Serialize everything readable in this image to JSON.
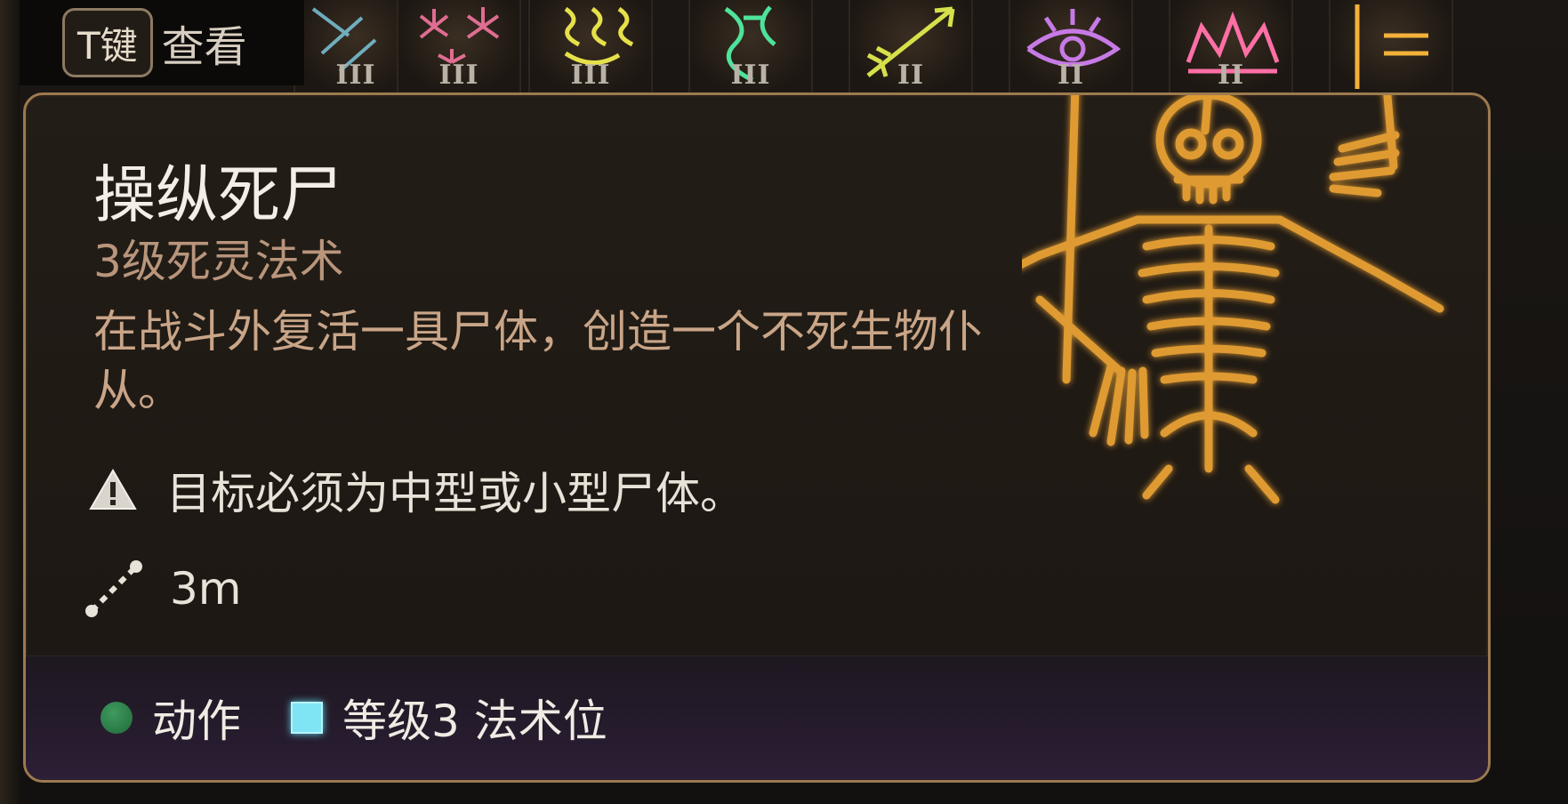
{
  "hint": {
    "key": "T键",
    "label": "查看"
  },
  "spell_icons": [
    {
      "name": "spell-icon-frost",
      "level": "III",
      "color": "#7fd0e6"
    },
    {
      "name": "spell-icon-burst",
      "level": "III",
      "color": "#ff7aa6"
    },
    {
      "name": "spell-icon-lightning",
      "level": "III",
      "color": "#e6e04a"
    },
    {
      "name": "spell-icon-vines",
      "level": "III",
      "color": "#4ee39a"
    },
    {
      "name": "spell-icon-arrow",
      "level": "II",
      "color": "#d6e04a"
    },
    {
      "name": "spell-icon-eye",
      "level": "II",
      "color": "#c77ae6"
    },
    {
      "name": "spell-icon-crown",
      "level": "II",
      "color": "#ff6fa6"
    },
    {
      "name": "spell-icon-gold",
      "level": "",
      "color": "#f3b13a"
    }
  ],
  "tooltip": {
    "title": "操纵死尸",
    "subtitle": "3级死灵法术",
    "description": "在战斗外复活一具尸体，创造一个不死生物仆从。",
    "requirement": "目标必须为中型或小型尸体。",
    "range": "3m",
    "cost_action": "动作",
    "cost_slot": "等级3 法术位"
  },
  "colors": {
    "border": "#9c7a4f",
    "subtitle": "#b8957b",
    "skeleton_glow": "#f0a634",
    "action_dot": "#2e8a4e",
    "slot": "#7fe4f4"
  }
}
